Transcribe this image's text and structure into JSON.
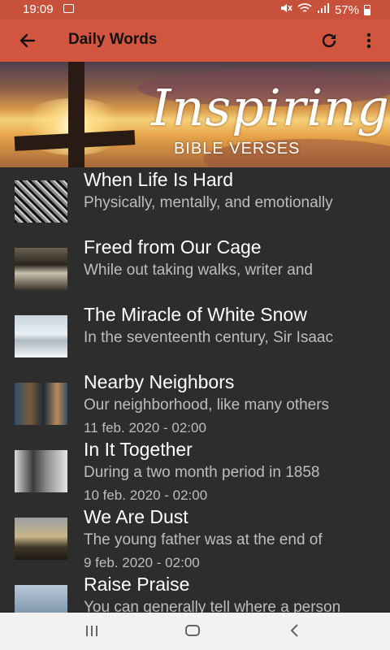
{
  "status": {
    "time": "19:09",
    "battery": "57%"
  },
  "appbar": {
    "title": "Daily Words"
  },
  "banner": {
    "script_text": "Inspiring",
    "subtitle": "BIBLE VERSES"
  },
  "items": [
    {
      "title": "When Life Is Hard",
      "desc": "Physically, mentally, and emotionally",
      "date": ""
    },
    {
      "title": "Freed from Our Cage",
      "desc": "While out taking walks, writer and",
      "date": ""
    },
    {
      "title": "The Miracle of White Snow",
      "desc": "In the seventeenth century, Sir Isaac",
      "date": ""
    },
    {
      "title": "Nearby Neighbors",
      "desc": "Our neighborhood, like many others",
      "date": "11 feb. 2020 - 02:00"
    },
    {
      "title": "In It Together",
      "desc": "During a two month period in 1858",
      "date": "10 feb. 2020 - 02:00"
    },
    {
      "title": "We Are Dust",
      "desc": "The young father was at the end of",
      "date": "9 feb. 2020 - 02:00"
    },
    {
      "title": "Raise Praise",
      "desc": "You can generally tell where a person",
      "date": ""
    }
  ]
}
